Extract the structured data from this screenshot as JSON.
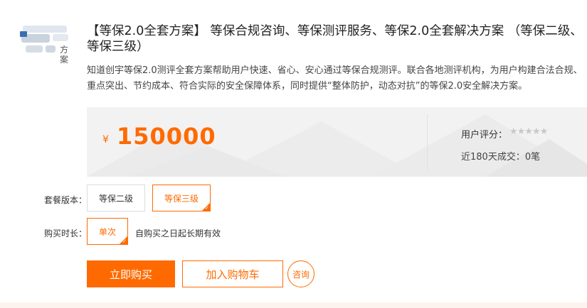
{
  "product": {
    "logo_text": "方案",
    "title": "【等保2.0全套方案】 等保合规咨询、等保测评服务、等保2.0全套解决方案 （等保二级、等保三级）",
    "description": "知道创宇等保2.0测评全套方案帮助用户快速、省心、安心通过等保合规测评。联合各地测评机构，为用户构建合法合规、重点突出、节约成本、符合实际的安全保障体系，同时提供“整体防护，动态对抗”的等保2.0安全解决方案。"
  },
  "price": {
    "currency": "¥",
    "amount": "150000",
    "rating_label": "用户评分：",
    "rating_stars": "★★★★★",
    "rating_value": 0,
    "deals": "近180天成交：0笔"
  },
  "options": {
    "package_label": "套餐版本：",
    "packages": [
      {
        "label": "等保二级",
        "selected": false
      },
      {
        "label": "等保三级",
        "selected": true
      }
    ],
    "duration_label": "购买时长：",
    "durations": [
      {
        "label": "单次",
        "selected": true
      }
    ],
    "validity": "自购买之日起长期有效"
  },
  "actions": {
    "buy": "立即购买",
    "cart": "加入购物车",
    "consult": "咨询"
  },
  "colors": {
    "accent": "#ff6a00",
    "panel": "#f2f2f2"
  }
}
